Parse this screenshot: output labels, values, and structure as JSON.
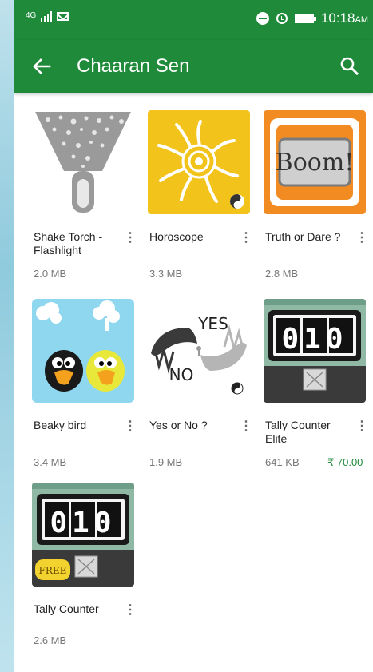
{
  "status_bar": {
    "network": "4G",
    "time": "10:18",
    "ampm": "AM"
  },
  "app_bar": {
    "title": "Chaaran Sen"
  },
  "apps": [
    {
      "name": "Shake Torch - Flashlight",
      "size": "2.0 MB",
      "icon": "flashlight-icon"
    },
    {
      "name": "Horoscope",
      "size": "3.3 MB",
      "icon": "sun-icon"
    },
    {
      "name": "Truth or Dare ?",
      "size": "2.8 MB",
      "icon": "boom-sign-icon",
      "icon_text": "Boom!"
    },
    {
      "name": "Beaky bird",
      "size": "3.4 MB",
      "icon": "birds-icon"
    },
    {
      "name": "Yes or No ?",
      "size": "1.9 MB",
      "icon": "yes-no-icon",
      "icon_text_yes": "YES",
      "icon_text_no": "NO"
    },
    {
      "name": "Tally Counter Elite",
      "size": "641 KB",
      "price": "₹ 70.00",
      "icon": "counter-icon",
      "icon_text": "010"
    },
    {
      "name": "Tally Counter",
      "size": "2.6 MB",
      "icon": "counter-free-icon",
      "icon_text": "010",
      "badge": "FREE"
    }
  ],
  "colors": {
    "accent": "#1e8a3a",
    "price": "#1e8a3a",
    "horoscope_bg": "#f2c41b",
    "truth_bg": "#f28b22"
  }
}
